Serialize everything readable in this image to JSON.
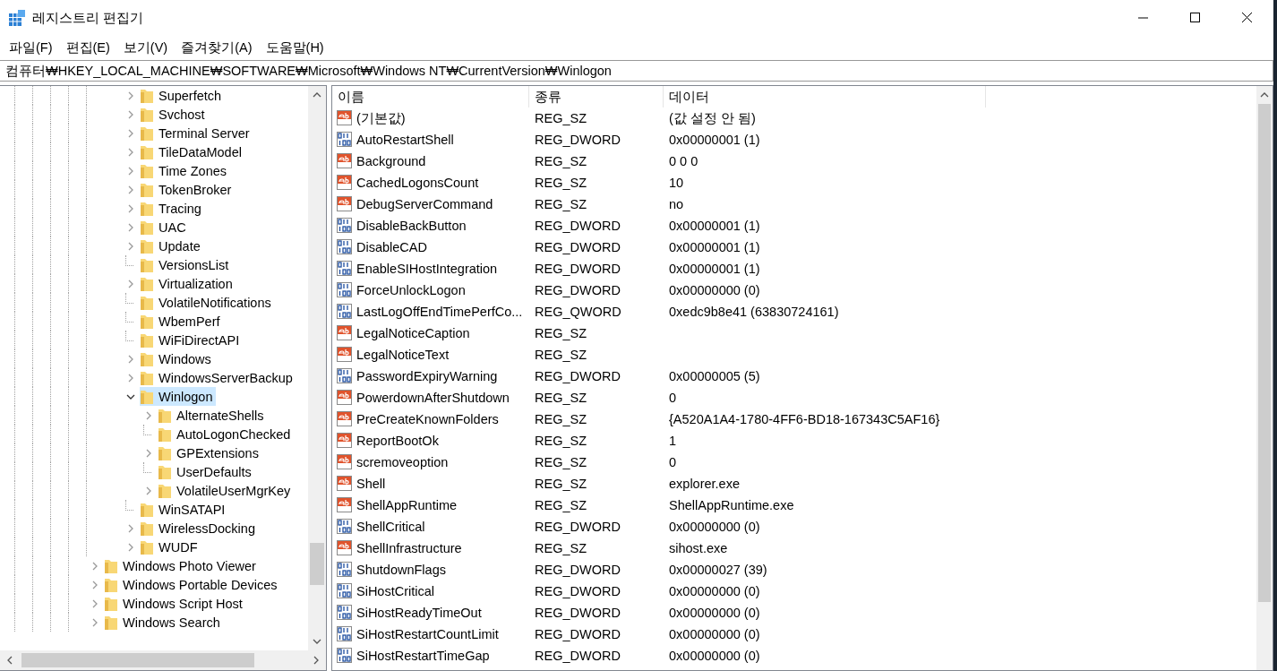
{
  "window": {
    "title": "레지스트리 편집기"
  },
  "menu": [
    {
      "label": "파일(F)"
    },
    {
      "label": "편집(E)"
    },
    {
      "label": "보기(V)"
    },
    {
      "label": "즐겨찾기(A)"
    },
    {
      "label": "도움말(H)"
    }
  ],
  "address": "컴퓨터₩HKEY_LOCAL_MACHINE₩SOFTWARE₩Microsoft₩Windows NT₩CurrentVersion₩Winlogon",
  "tree": {
    "items": [
      {
        "children": [
          {
            "children": [
              {
                "label": "Superfetch",
                "expandable": true,
                "expanded": false,
                "selected": false
              },
              {
                "label": "Svchost",
                "expandable": true,
                "expanded": false,
                "selected": false
              },
              {
                "label": "Terminal Server",
                "expandable": true,
                "expanded": false,
                "selected": false
              },
              {
                "label": "TileDataModel",
                "expandable": true,
                "expanded": false,
                "selected": false
              },
              {
                "label": "Time Zones",
                "expandable": true,
                "expanded": false,
                "selected": false
              },
              {
                "label": "TokenBroker",
                "expandable": true,
                "expanded": false,
                "selected": false
              },
              {
                "label": "Tracing",
                "expandable": true,
                "expanded": false,
                "selected": false
              },
              {
                "label": "UAC",
                "expandable": true,
                "expanded": false,
                "selected": false
              },
              {
                "label": "Update",
                "expandable": true,
                "expanded": false,
                "selected": false
              },
              {
                "label": "VersionsList",
                "expandable": false,
                "selected": false
              },
              {
                "label": "Virtualization",
                "expandable": true,
                "expanded": false,
                "selected": false
              },
              {
                "label": "VolatileNotifications",
                "expandable": false,
                "selected": false
              },
              {
                "label": "WbemPerf",
                "expandable": false,
                "selected": false
              },
              {
                "label": "WiFiDirectAPI",
                "expandable": false,
                "selected": false
              },
              {
                "label": "Windows",
                "expandable": true,
                "expanded": false,
                "selected": false
              },
              {
                "label": "WindowsServerBackup",
                "expandable": true,
                "expanded": false,
                "selected": false
              },
              {
                "label": "Winlogon",
                "expandable": true,
                "expanded": true,
                "selected": true,
                "children": [
                  {
                    "label": "AlternateShells",
                    "expandable": true,
                    "expanded": false,
                    "selected": false
                  },
                  {
                    "label": "AutoLogonChecked",
                    "expandable": false,
                    "selected": false
                  },
                  {
                    "label": "GPExtensions",
                    "expandable": true,
                    "expanded": false,
                    "selected": false
                  },
                  {
                    "label": "UserDefaults",
                    "expandable": false,
                    "selected": false
                  },
                  {
                    "label": "VolatileUserMgrKey",
                    "expandable": true,
                    "expanded": false,
                    "selected": false
                  }
                ]
              },
              {
                "label": "WinSATAPI",
                "expandable": false,
                "selected": false
              },
              {
                "label": "WirelessDocking",
                "expandable": true,
                "expanded": false,
                "selected": false
              },
              {
                "label": "WUDF",
                "expandable": true,
                "expanded": false,
                "selected": false
              }
            ]
          }
        ]
      },
      {
        "label": "Windows Photo Viewer",
        "expandable": true,
        "expanded": false,
        "selected": false
      },
      {
        "label": "Windows Portable Devices",
        "expandable": true,
        "expanded": false,
        "selected": false
      },
      {
        "label": "Windows Script Host",
        "expandable": true,
        "expanded": false,
        "selected": false
      },
      {
        "label": "Windows Search",
        "expandable": true,
        "expanded": false,
        "selected": false
      }
    ]
  },
  "table": {
    "columns": [
      "이름",
      "종류",
      "데이터"
    ],
    "rows": [
      {
        "kind": "string",
        "name": "(기본값)",
        "type": "REG_SZ",
        "data": "(값 설정 안 됨)"
      },
      {
        "kind": "binary",
        "name": "AutoRestartShell",
        "type": "REG_DWORD",
        "data": "0x00000001 (1)"
      },
      {
        "kind": "string",
        "name": "Background",
        "type": "REG_SZ",
        "data": "0 0 0"
      },
      {
        "kind": "string",
        "name": "CachedLogonsCount",
        "type": "REG_SZ",
        "data": "10"
      },
      {
        "kind": "string",
        "name": "DebugServerCommand",
        "type": "REG_SZ",
        "data": "no"
      },
      {
        "kind": "binary",
        "name": "DisableBackButton",
        "type": "REG_DWORD",
        "data": "0x00000001 (1)"
      },
      {
        "kind": "binary",
        "name": "DisableCAD",
        "type": "REG_DWORD",
        "data": "0x00000001 (1)"
      },
      {
        "kind": "binary",
        "name": "EnableSIHostIntegration",
        "type": "REG_DWORD",
        "data": "0x00000001 (1)"
      },
      {
        "kind": "binary",
        "name": "ForceUnlockLogon",
        "type": "REG_DWORD",
        "data": "0x00000000 (0)"
      },
      {
        "kind": "binary",
        "name": "LastLogOffEndTimePerfCo...",
        "type": "REG_QWORD",
        "data": "0xedc9b8e41 (63830724161)"
      },
      {
        "kind": "string",
        "name": "LegalNoticeCaption",
        "type": "REG_SZ"
      },
      {
        "kind": "string",
        "name": "LegalNoticeText",
        "type": "REG_SZ"
      },
      {
        "kind": "binary",
        "name": "PasswordExpiryWarning",
        "type": "REG_DWORD",
        "data": "0x00000005 (5)"
      },
      {
        "kind": "string",
        "name": "PowerdownAfterShutdown",
        "type": "REG_SZ",
        "data": "0"
      },
      {
        "kind": "string",
        "name": "PreCreateKnownFolders",
        "type": "REG_SZ",
        "data": "{A520A1A4-1780-4FF6-BD18-167343C5AF16}"
      },
      {
        "kind": "string",
        "name": "ReportBootOk",
        "type": "REG_SZ",
        "data": "1"
      },
      {
        "kind": "string",
        "name": "scremoveoption",
        "type": "REG_SZ",
        "data": "0"
      },
      {
        "kind": "string",
        "name": "Shell",
        "type": "REG_SZ",
        "data": "explorer.exe"
      },
      {
        "kind": "string",
        "name": "ShellAppRuntime",
        "type": "REG_SZ",
        "data": "ShellAppRuntime.exe"
      },
      {
        "kind": "binary",
        "name": "ShellCritical",
        "type": "REG_DWORD",
        "data": "0x00000000 (0)"
      },
      {
        "kind": "string",
        "name": "ShellInfrastructure",
        "type": "REG_SZ",
        "data": "sihost.exe"
      },
      {
        "kind": "binary",
        "name": "ShutdownFlags",
        "type": "REG_DWORD",
        "data": "0x00000027 (39)"
      },
      {
        "kind": "binary",
        "name": "SiHostCritical",
        "type": "REG_DWORD",
        "data": "0x00000000 (0)"
      },
      {
        "kind": "binary",
        "name": "SiHostReadyTimeOut",
        "type": "REG_DWORD",
        "data": "0x00000000 (0)"
      },
      {
        "kind": "binary",
        "name": "SiHostRestartCountLimit",
        "type": "REG_DWORD",
        "data": "0x00000000 (0)"
      },
      {
        "kind": "binary",
        "name": "SiHostRestartTimeGap",
        "type": "REG_DWORD",
        "data": "0x00000000 (0)"
      }
    ]
  }
}
